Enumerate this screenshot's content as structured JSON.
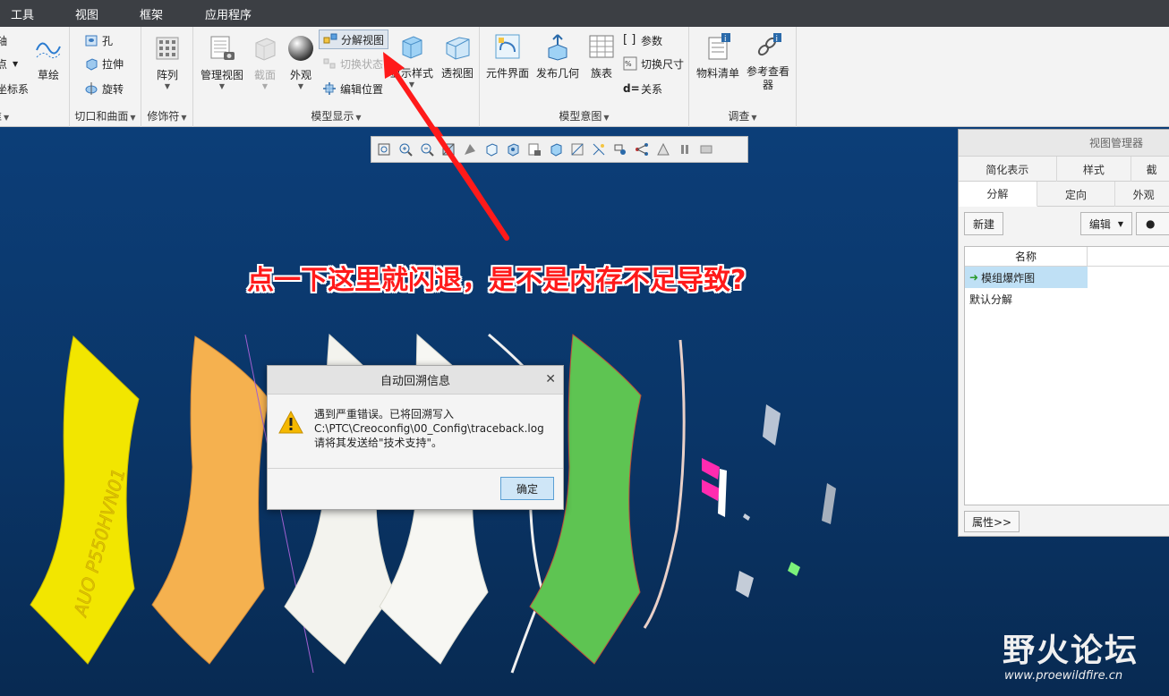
{
  "menubar": {
    "items": [
      "工具",
      "视图",
      "框架",
      "应用程序"
    ]
  },
  "ribbon": {
    "left_partial": {
      "items": [
        "轴",
        "点",
        "坐标系"
      ],
      "sketch": "草绘",
      "group_label": "准"
    },
    "cut": {
      "hole": "孔",
      "extrude": "拉伸",
      "revolve": "旋转",
      "group_label": "切口和曲面"
    },
    "mod": {
      "pattern": "阵列",
      "group_label": "修饰符"
    },
    "model_display": {
      "manage_view": "管理视图",
      "section": "截面",
      "appearance": "外观",
      "explode_view": "分解视图",
      "toggle_status": "切换状态",
      "edit_position": "编辑位置",
      "display_style": "显示样式",
      "perspective": "透视图",
      "group_label": "模型显示"
    },
    "model_intent": {
      "component_interface": "元件界面",
      "publish_geometry": "发布几何",
      "family_table": "族表",
      "parameters": "参数",
      "switch_dims": "切换尺寸",
      "relations": "关系",
      "group_label": "模型意图"
    },
    "investigate": {
      "bom": "物料清单",
      "ref_viewer": "参考查看器",
      "group_label": "调查"
    }
  },
  "annotation": "点一下这里就闪退，是不是内存不足导致?",
  "dialog": {
    "title": "自动回溯信息",
    "line1": "遇到严重错误。已将回溯写入",
    "line2": "C:\\PTC\\Creoconfig\\00_Config\\traceback.log",
    "line3": "请将其发送给\"技术支持\"。",
    "ok": "确定"
  },
  "view_manager": {
    "title": "视图管理器",
    "tabs_row1": [
      "简化表示",
      "样式",
      "截"
    ],
    "tabs_row2": [
      "分解",
      "定向",
      "外观"
    ],
    "new_btn": "新建",
    "edit_btn": "编辑",
    "col_name": "名称",
    "rows": [
      "模组爆炸图",
      "默认分解"
    ],
    "properties": "属性>>"
  },
  "part_text": "AUO P550HVN01",
  "watermark": {
    "title": "野火论坛",
    "url": "www.proewildfire.cn"
  },
  "colors": {
    "arrow": "#ff1a1a",
    "yellow_part": "#f2e600",
    "orange_part": "#f5b14f",
    "green_part": "#5ec452",
    "bg": "#0a3a73"
  }
}
